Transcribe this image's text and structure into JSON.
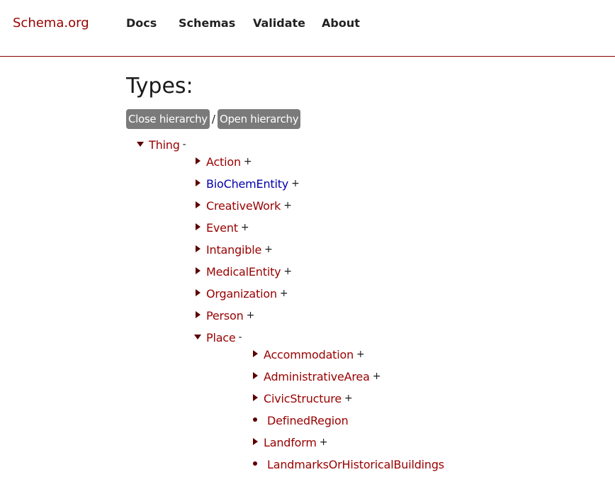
{
  "header": {
    "logo": "Schema.org",
    "nav": [
      "Docs",
      "Schemas",
      "Validate",
      "About"
    ]
  },
  "page": {
    "title": "Types:",
    "close_hierarchy": "Close hierarchy",
    "separator": "/",
    "open_hierarchy": "Open hierarchy"
  },
  "colors": {
    "link": "#990000",
    "visited_link": "#0000aa",
    "button_bg": "#7a7a7a",
    "divider": "#8b0000"
  },
  "tree": {
    "root": {
      "label": "Thing",
      "toggle": "-",
      "icon": "caret-down-icon"
    },
    "level1": [
      {
        "label": "Action",
        "toggle": "+",
        "icon": "caret-right-icon"
      },
      {
        "label": "BioChemEntity",
        "toggle": "+",
        "icon": "caret-right-icon",
        "color": "#0000aa"
      },
      {
        "label": "CreativeWork",
        "toggle": "+",
        "icon": "caret-right-icon"
      },
      {
        "label": "Event",
        "toggle": "+",
        "icon": "caret-right-icon"
      },
      {
        "label": "Intangible",
        "toggle": "+",
        "icon": "caret-right-icon"
      },
      {
        "label": "MedicalEntity",
        "toggle": "+",
        "icon": "caret-right-icon"
      },
      {
        "label": "Organization",
        "toggle": "+",
        "icon": "caret-right-icon"
      },
      {
        "label": "Person",
        "toggle": "+",
        "icon": "caret-right-icon"
      },
      {
        "label": "Place",
        "toggle": "-",
        "icon": "caret-down-icon"
      }
    ],
    "place_children": [
      {
        "label": "Accommodation",
        "toggle": "+",
        "icon": "caret-right-icon"
      },
      {
        "label": "AdministrativeArea",
        "toggle": "+",
        "icon": "caret-right-icon"
      },
      {
        "label": "CivicStructure",
        "toggle": "+",
        "icon": "caret-right-icon"
      },
      {
        "label": "DefinedRegion",
        "toggle": "",
        "icon": "bullet-icon"
      },
      {
        "label": "Landform",
        "toggle": "+",
        "icon": "caret-right-icon"
      },
      {
        "label": "LandmarksOrHistoricalBuildings",
        "toggle": "",
        "icon": "bullet-icon"
      }
    ]
  }
}
